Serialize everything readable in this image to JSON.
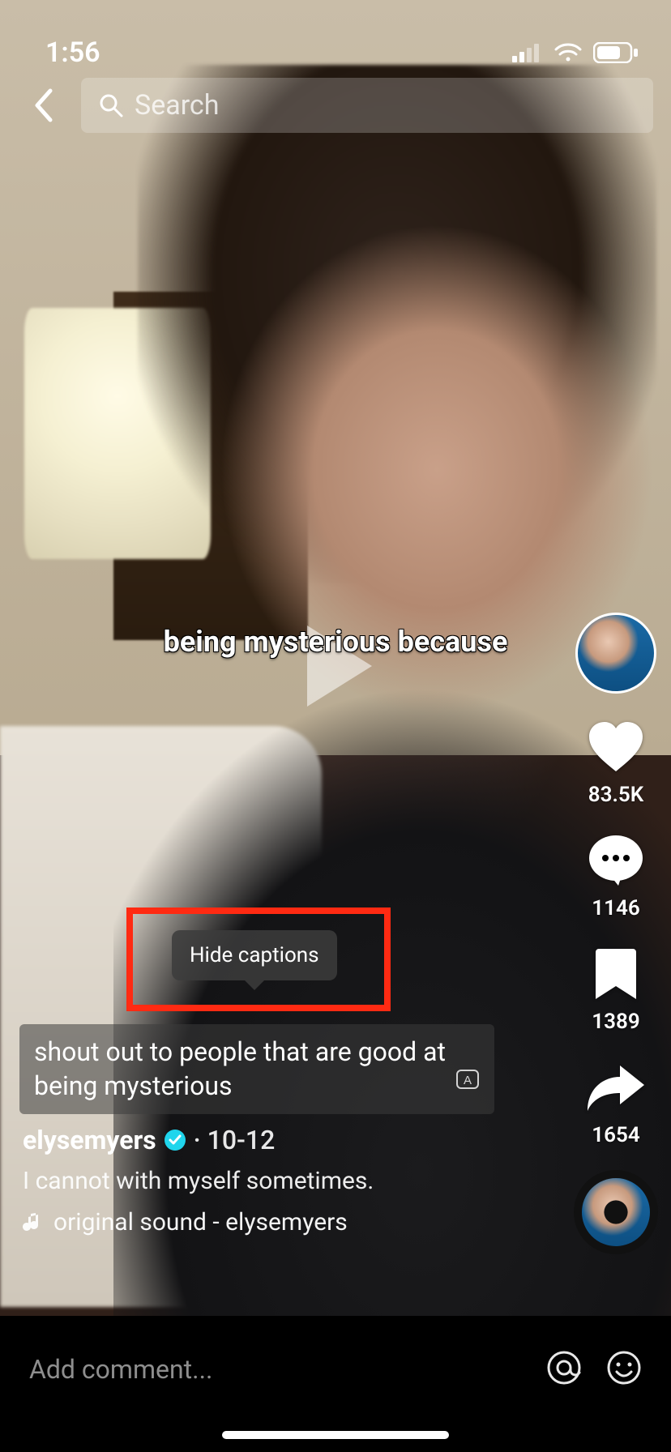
{
  "status_bar": {
    "time": "1:56"
  },
  "header": {
    "search_placeholder": "Search"
  },
  "video": {
    "center_caption": "being mysterious because",
    "full_caption": "shout out to people that are good at being mysterious",
    "hide_captions_label": "Hide captions"
  },
  "meta": {
    "username": "elysemyers",
    "date": "10-12",
    "description": "I cannot with myself sometimes.",
    "sound": "original sound - elysemyers"
  },
  "rail": {
    "likes": "83.5K",
    "comments": "1146",
    "bookmarks": "1389",
    "shares": "1654"
  },
  "comment": {
    "placeholder": "Add comment..."
  }
}
